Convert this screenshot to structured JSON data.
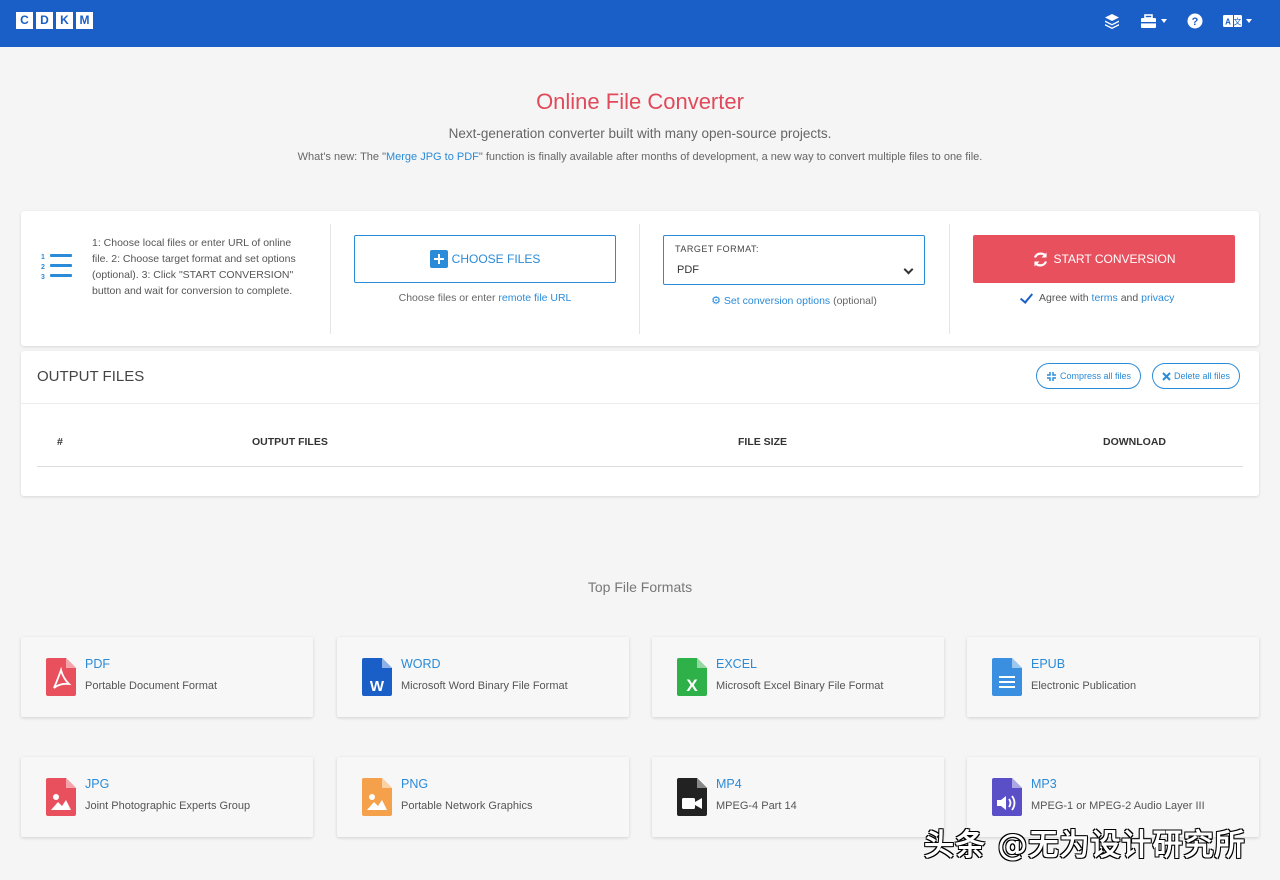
{
  "nav": {
    "logo_letters": [
      "C",
      "D",
      "K",
      "M"
    ],
    "icons": [
      "layers-icon",
      "toolbox-icon",
      "help-icon",
      "language-icon"
    ]
  },
  "hero": {
    "title": "Online File Converter",
    "subtitle": "Next-generation converter built with many open-source projects.",
    "news_prefix": "What's new: The \"",
    "news_link": "Merge JPG to PDF",
    "news_suffix": "\" function is finally available after months of development, a new way to convert multiple files to one file."
  },
  "converter": {
    "steps": "1: Choose local files or enter URL of online file. 2: Choose target format and set options (optional). 3: Click \"START CONVERSION\" button and wait for conversion to complete.",
    "choose_label": "CHOOSE FILES",
    "choose_hint_prefix": "Choose files or enter ",
    "choose_hint_link": "remote file URL",
    "target_label": "TARGET FORMAT:",
    "target_value": "PDF",
    "options_link": "Set conversion options",
    "options_suffix": " (optional)",
    "start_label": "START CONVERSION",
    "agree_prefix": "Agree with ",
    "agree_terms": "terms",
    "agree_and": " and ",
    "agree_privacy": "privacy",
    "agree_checked": true
  },
  "output": {
    "title": "OUTPUT FILES",
    "compress_label": "Compress all files",
    "delete_label": "Delete all files",
    "columns": [
      "#",
      "OUTPUT FILES",
      "FILE SIZE",
      "DOWNLOAD"
    ]
  },
  "formats": {
    "heading": "Top File Formats",
    "items": [
      {
        "name": "PDF",
        "desc": "Portable Document Format",
        "icon": "pdf-file-icon",
        "color": "#e8505e"
      },
      {
        "name": "WORD",
        "desc": "Microsoft Word Binary File Format",
        "icon": "word-file-icon",
        "color": "#1a5fc8"
      },
      {
        "name": "EXCEL",
        "desc": "Microsoft Excel Binary File Format",
        "icon": "excel-file-icon",
        "color": "#2fb14a"
      },
      {
        "name": "EPUB",
        "desc": "Electronic Publication",
        "icon": "epub-file-icon",
        "color": "#3a8fe0"
      },
      {
        "name": "JPG",
        "desc": "Joint Photographic Experts Group",
        "icon": "jpg-file-icon",
        "color": "#e8505e"
      },
      {
        "name": "PNG",
        "desc": "Portable Network Graphics",
        "icon": "png-file-icon",
        "color": "#f5a04a"
      },
      {
        "name": "MP4",
        "desc": "MPEG-4 Part 14",
        "icon": "mp4-file-icon",
        "color": "#222222"
      },
      {
        "name": "MP3",
        "desc": "MPEG-1 or MPEG-2 Audio Layer III",
        "icon": "mp3-file-icon",
        "color": "#5b4fc8"
      }
    ]
  },
  "watermark": "头条 @无为设计研究所"
}
